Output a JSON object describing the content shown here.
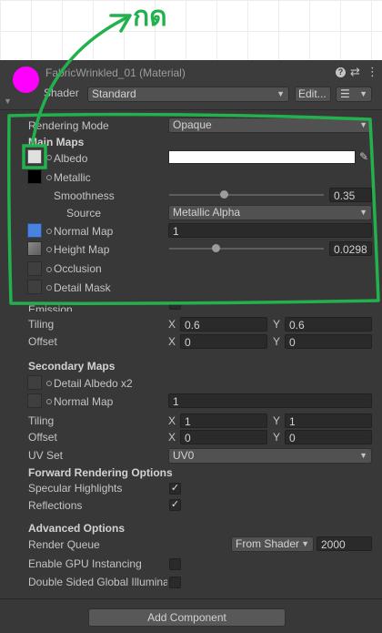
{
  "annotation": {
    "handwritten_text": "กด",
    "color": "#23b14d"
  },
  "header": {
    "title": "FabricWrinkled_01 (Material)",
    "shader_label": "Shader",
    "shader_value": "Standard",
    "edit_label": "Edit...",
    "icon_color": "#ff00ff"
  },
  "rendering_mode": {
    "label": "Rendering Mode",
    "value": "Opaque"
  },
  "main_maps": {
    "title": "Main Maps",
    "albedo_label": "Albedo",
    "albedo_color": "#ffffff",
    "metallic_label": "Metallic",
    "smoothness": {
      "label": "Smoothness",
      "value": "0.35",
      "fraction": 0.35
    },
    "source": {
      "label": "Source",
      "value": "Metallic Alpha"
    },
    "normal_map": {
      "label": "Normal Map",
      "value": "1"
    },
    "height_map": {
      "label": "Height Map",
      "value": "0.0298",
      "fraction": 0.3
    },
    "occlusion_label": "Occlusion",
    "detail_mask_label": "Detail Mask",
    "emission_label": "Emission",
    "tiling": {
      "label": "Tiling",
      "x": "0.6",
      "y": "0.6"
    },
    "offset": {
      "label": "Offset",
      "x": "0",
      "y": "0"
    }
  },
  "secondary_maps": {
    "title": "Secondary Maps",
    "detail_albedo_label": "Detail Albedo x2",
    "normal_map": {
      "label": "Normal Map",
      "value": "1"
    },
    "tiling": {
      "label": "Tiling",
      "x": "1",
      "y": "1"
    },
    "offset": {
      "label": "Offset",
      "x": "0",
      "y": "0"
    },
    "uv_set": {
      "label": "UV Set",
      "value": "UV0"
    }
  },
  "forward_rendering": {
    "title": "Forward Rendering Options",
    "specular_label": "Specular Highlights",
    "reflections_label": "Reflections",
    "check_glyph": "✓"
  },
  "advanced": {
    "title": "Advanced Options",
    "render_queue_label": "Render Queue",
    "render_queue_mode": "From Shader",
    "render_queue_value": "2000",
    "gpu_instancing_label": "Enable GPU Instancing",
    "double_sided_label": "Double Sided Global Illumina"
  },
  "axis": {
    "x": "X",
    "y": "Y"
  },
  "add_component_label": "Add Component"
}
